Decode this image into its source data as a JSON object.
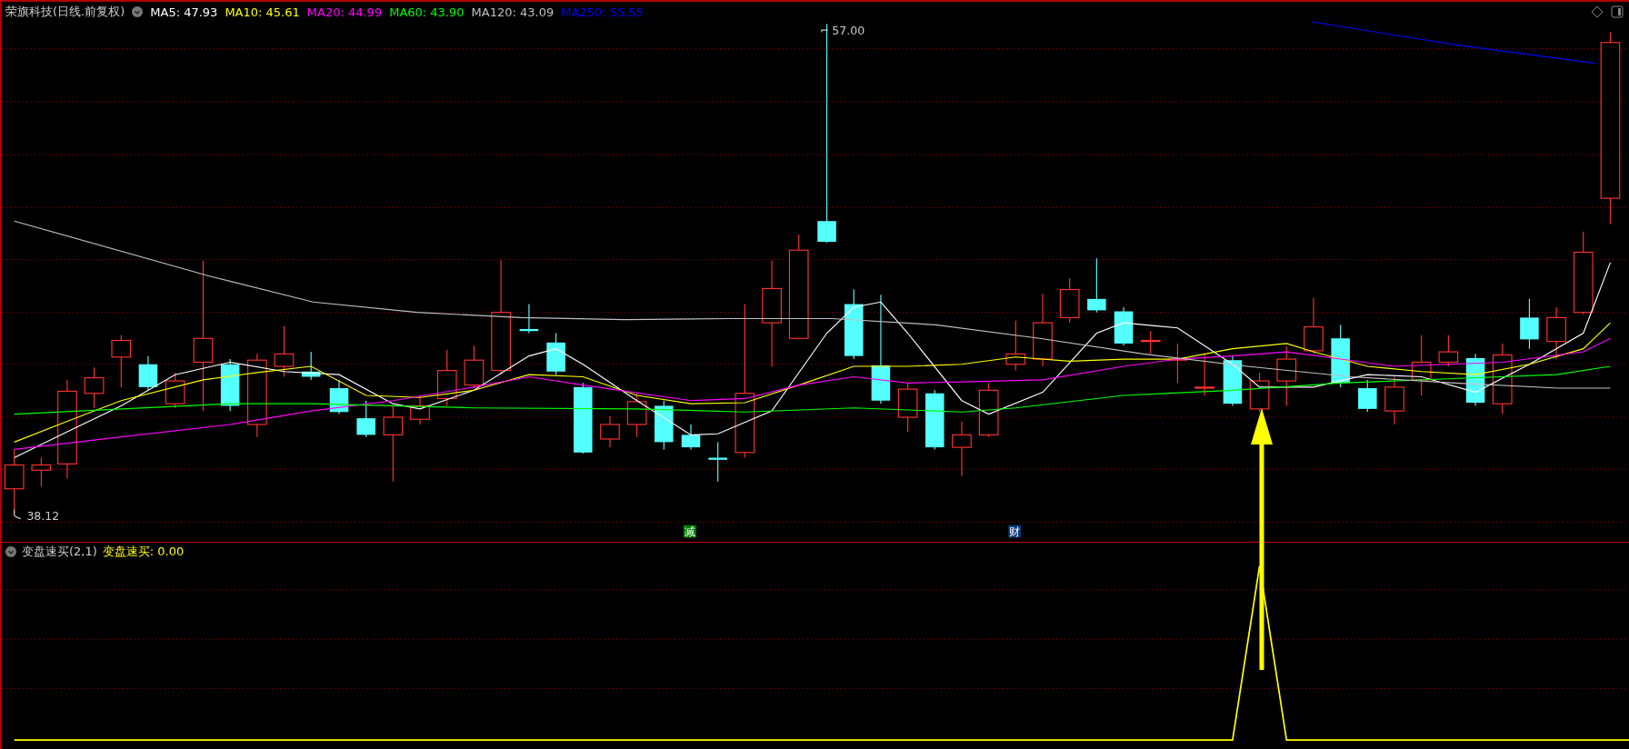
{
  "chart": {
    "title": "荣旗科技(日线.前复权)",
    "ma_legend": [
      {
        "label": "MA5: 47.93",
        "color": "#ffffff"
      },
      {
        "label": "MA10: 45.61",
        "color": "#ffff00"
      },
      {
        "label": "MA20: 44.99",
        "color": "#ff00ff"
      },
      {
        "label": "MA60: 43.90",
        "color": "#00ff00"
      },
      {
        "label": "MA120: 43.09",
        "color": "#c0c0c0"
      },
      {
        "label": "MA250: 55.55",
        "color": "#0000ff"
      }
    ],
    "price_marks": [
      {
        "text": "57.00"
      },
      {
        "text": "38.12"
      }
    ],
    "event_markers": [
      {
        "text": "减",
        "color": "#008000"
      },
      {
        "text": "财",
        "color": "#0a3a7a"
      }
    ]
  },
  "indicator": {
    "name": "变盘速买(2,1)",
    "value_label": "变盘速买: 0.00"
  }
}
